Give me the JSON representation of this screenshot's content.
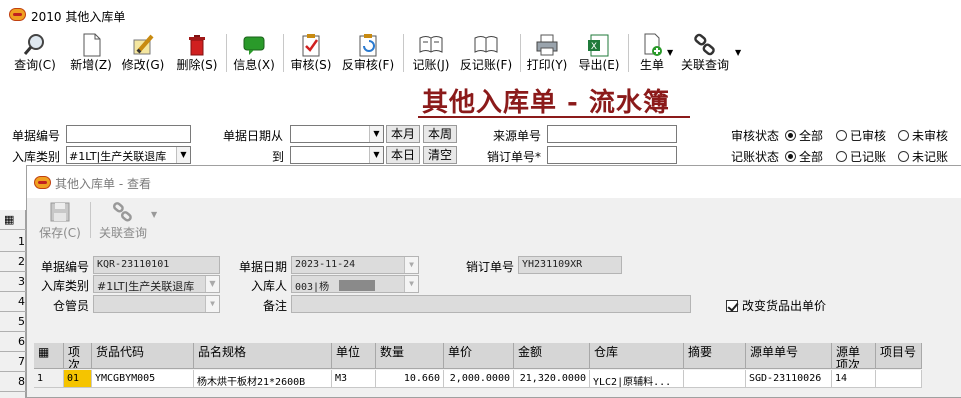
{
  "window": {
    "title": "2010 其他入库单"
  },
  "toolbar": {
    "query": "查询(C)",
    "add": "新增(Z)",
    "edit": "修改(G)",
    "delete": "删除(S)",
    "info": "信息(X)",
    "audit": "审核(S)",
    "unaudit": "反审核(F)",
    "post": "记账(J)",
    "unpost": "反记账(F)",
    "print": "打印(Y)",
    "export": "导出(E)",
    "generate": "生单",
    "related": "关联查询"
  },
  "heading": "其他入库单 - 流水簿",
  "filters": {
    "doc_no_label": "单据编号",
    "doc_no_value": "",
    "type_label": "入库类别",
    "type_value": "#1LT|生产关联退库",
    "date_from_label": "单据日期从",
    "date_to_label": "到",
    "this_month": "本月",
    "this_week": "本周",
    "today": "本日",
    "clear": "清空",
    "source_no_label": "来源单号",
    "sales_no_label": "销订单号*",
    "audit_label": "审核状态",
    "post_label": "记账状态",
    "audit_options": [
      "全部",
      "已审核",
      "未审核"
    ],
    "post_options": [
      "全部",
      "已记账",
      "未记账"
    ],
    "audit_selected": 0,
    "post_selected": 0
  },
  "back_grid": {
    "rows": [
      "1",
      "2",
      "3",
      "4",
      "5",
      "6",
      "7",
      "8"
    ]
  },
  "dialog": {
    "title": "其他入库单 - 查看",
    "save": "保存(C)",
    "related": "关联查询",
    "doc_no_label": "单据编号",
    "doc_no": "KQR-23110101",
    "date_label": "单据日期",
    "date": "2023-11-24",
    "sales_no_label": "销订单号",
    "sales_no": "YH231109XR",
    "type_label": "入库类别",
    "type": "#1LT|生产关联退库",
    "receiver_label": "入库人",
    "receiver": "003|杨",
    "keeper_label": "仓管员",
    "keeper": "",
    "remark_label": "备注",
    "remark": "",
    "change_price_label": "改变货品出单价",
    "change_price_checked": true,
    "grid": {
      "headers": [
        "项次",
        "货品代码",
        "品名规格",
        "单位",
        "数量",
        "单价",
        "金额",
        "仓库",
        "摘要",
        "源单单号",
        "源单项次",
        "项目号"
      ],
      "rows": [
        {
          "idx": "1",
          "item": "01",
          "code": "YMCGBYM005",
          "name": "杨木烘干板材21*2600B",
          "unit": "M3",
          "qty": "10.660",
          "price": "2,000.0000",
          "amount": "21,320.0000",
          "warehouse": "YLC2|原辅料...",
          "memo": "",
          "src_no": "SGD-23110026",
          "src_item": "14",
          "project": ""
        }
      ]
    }
  },
  "colors": {
    "heading": "#8b1a1a",
    "tb_red": "#d02020",
    "tb_green": "#2a9a2a"
  }
}
